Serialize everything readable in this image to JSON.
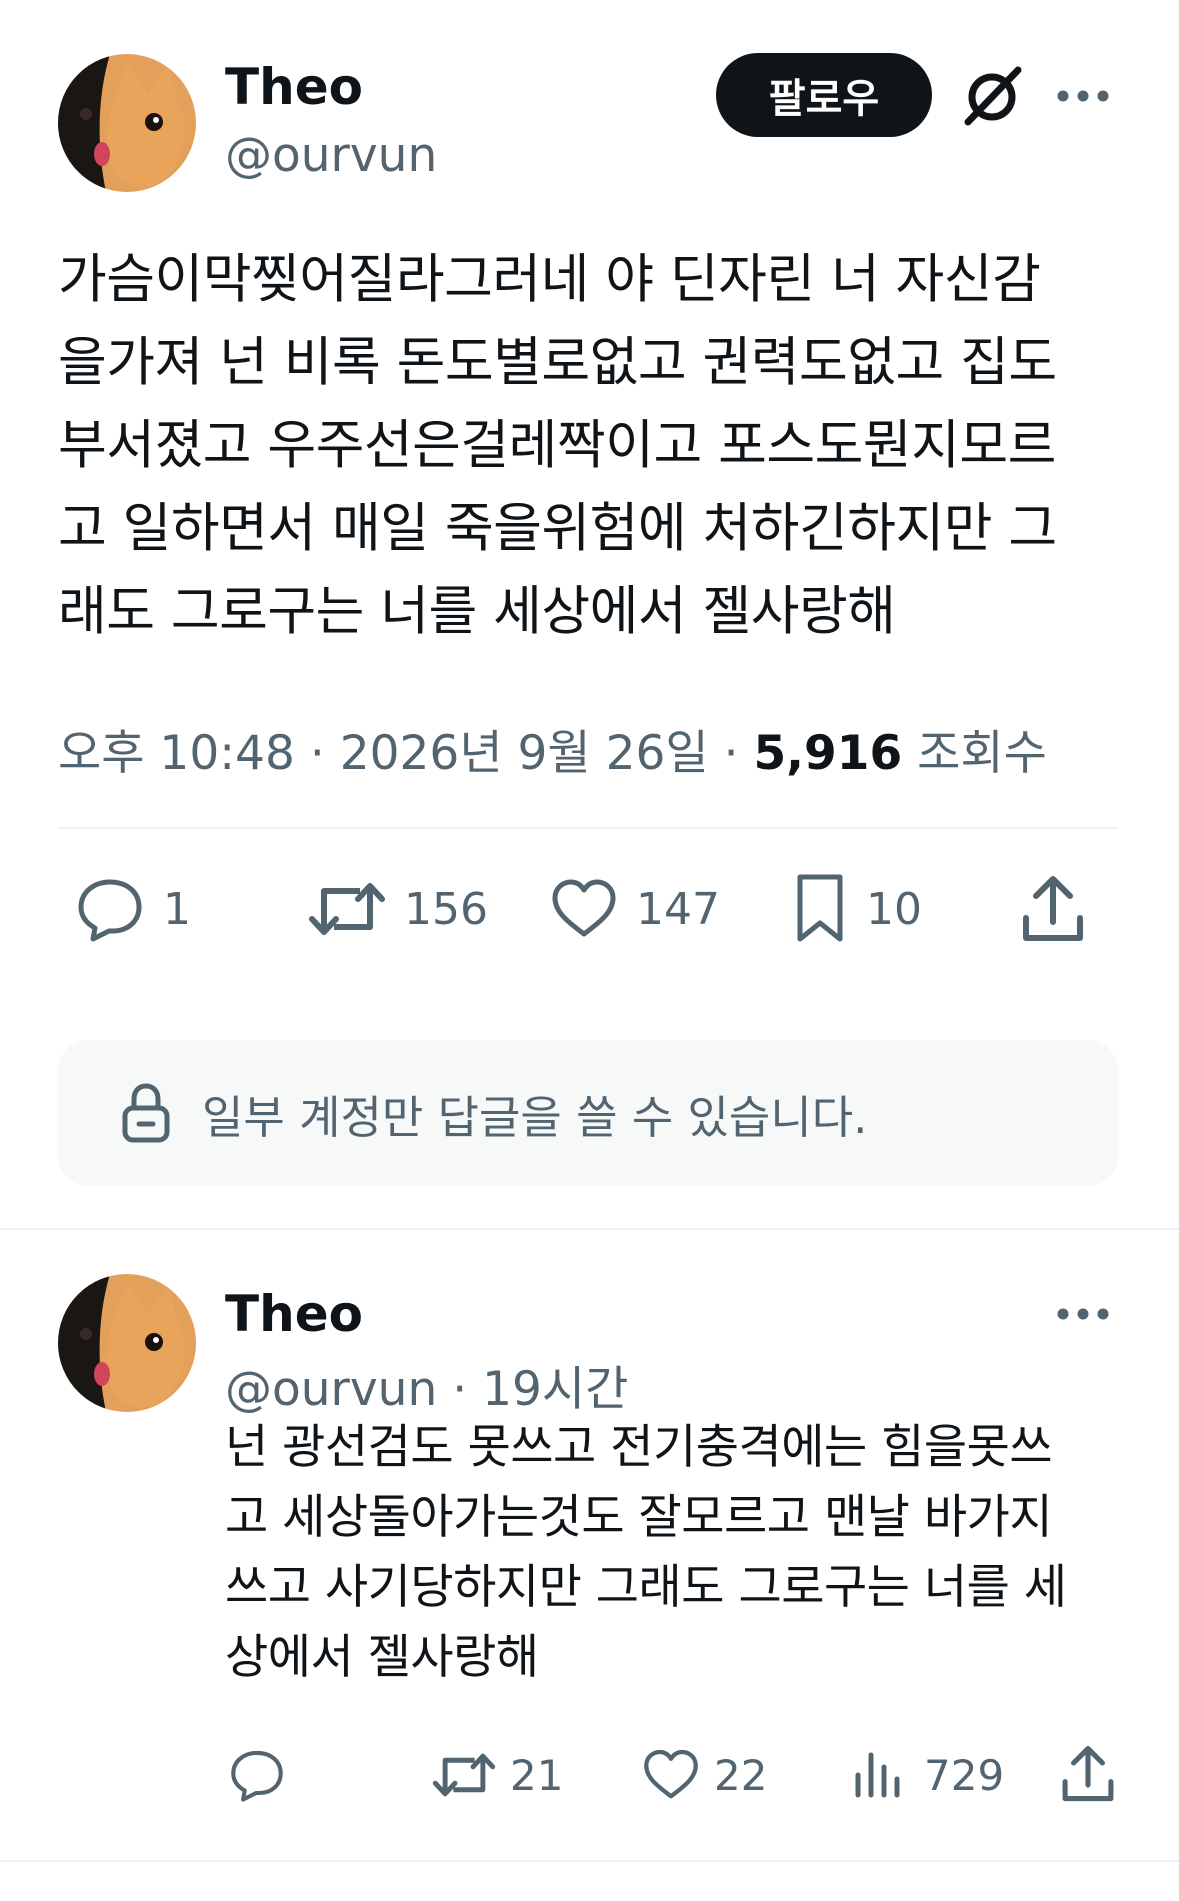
{
  "tweet": {
    "author_name": "Theo",
    "author_handle": "@ourvun",
    "follow_label": "팔로우",
    "text_lines": [
      "가슴이막찢어질라그러네 야 딘자린 너 자신감",
      "을가져 넌 비록 돈도별로없고 권력도없고 집도",
      "부서졌고 우주선은걸레짝이고 포스도뭔지모르",
      "고 일하면서 매일 죽을위험에 처하긴하지만 그",
      "래도 그로구는 너를 세상에서 젤사랑해"
    ],
    "time": "오후 10:48",
    "date": "2026년 9월 26일",
    "views_count": "5,916",
    "views_label": "조회수",
    "replies": "1",
    "retweets": "156",
    "likes": "147",
    "bookmarks": "10",
    "reply_restriction": "일부 계정만 답글을 쓸 수 있습니다."
  },
  "reply": {
    "author_name": "Theo",
    "author_handle": "@ourvun",
    "time_ago": "19시간",
    "text_lines": [
      "넌 광선검도 못쓰고 전기충격에는 힘을못쓰",
      "고 세상돌아가는것도 잘모르고 맨날 바가지",
      "쓰고 사기당하지만 그래도 그로구는 너를 세",
      "상에서 젤사랑해"
    ],
    "retweets": "21",
    "likes": "22",
    "views": "729"
  },
  "colors": {
    "text": "#0f1419",
    "secondary": "#536471",
    "divider": "#eff3f4",
    "panel": "#f7f9f9"
  }
}
